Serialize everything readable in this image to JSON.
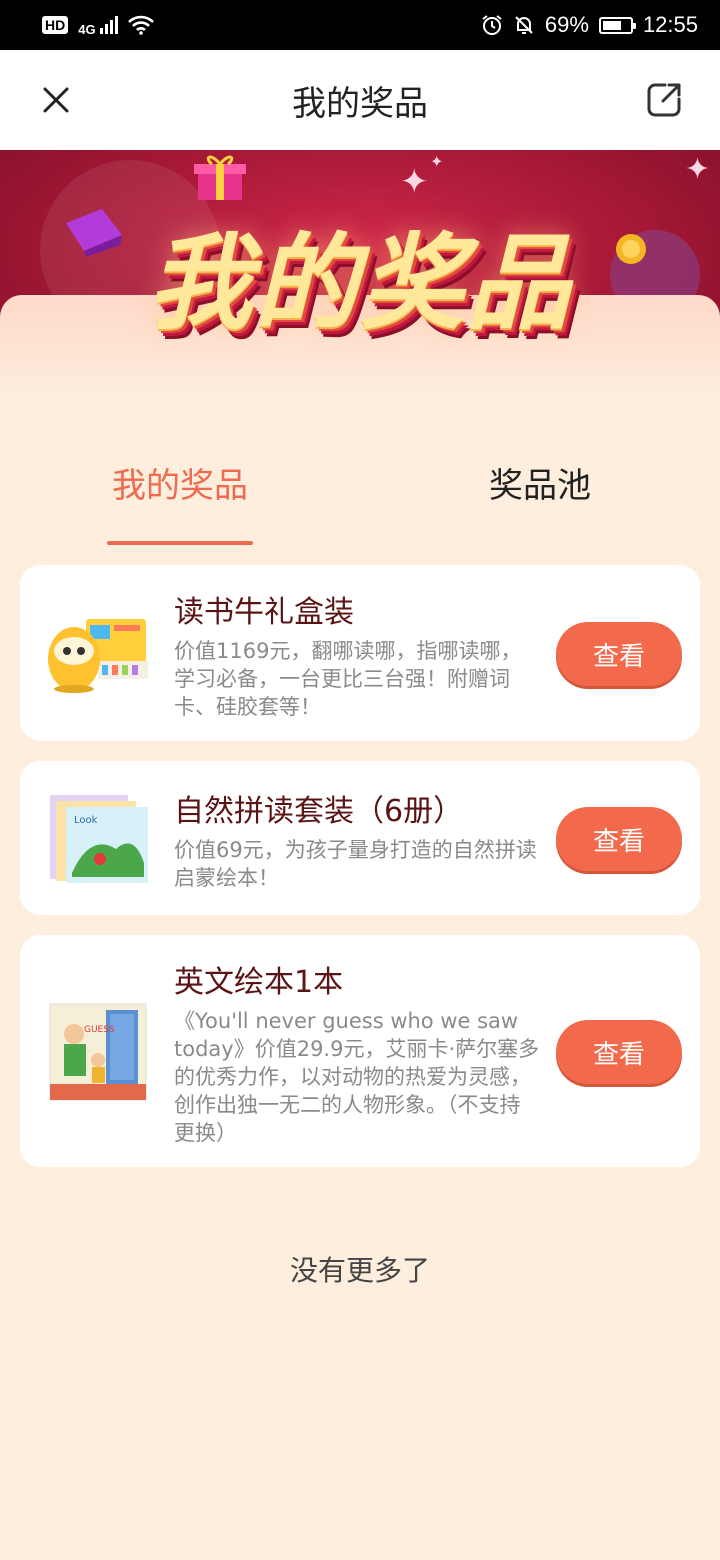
{
  "status": {
    "hd": "HD",
    "network": "4G",
    "battery_percent": "69%",
    "battery_level": 0.69,
    "time": "12:55"
  },
  "nav": {
    "title": "我的奖品",
    "close_icon": "close-icon",
    "share_icon": "share-icon"
  },
  "banner": {
    "title": "我的奖品"
  },
  "tabs": [
    {
      "label": "我的奖品",
      "active": true
    },
    {
      "label": "奖品池",
      "active": false
    }
  ],
  "prizes": [
    {
      "name": "读书牛礼盒装",
      "desc": "价值1169元，翻哪读哪，指哪读哪，学习必备，一台更比三台强！附赠词卡、硅胶套等！",
      "button": "查看"
    },
    {
      "name": "自然拼读套装（6册）",
      "desc": "价值69元，为孩子量身打造的自然拼读启蒙绘本！",
      "button": "查看"
    },
    {
      "name": "英文绘本1本",
      "desc": "《You'll never guess who we saw today》价值29.9元，艾丽卡·萨尔塞多的优秀力作，以对动物的热爱为灵感，创作出独一无二的人物形象。（不支持更换）",
      "button": "查看"
    }
  ],
  "footer": {
    "no_more": "没有更多了"
  },
  "colors": {
    "accent": "#ef6a4e",
    "button": "#f26a4b",
    "background": "#fdeedd",
    "prize_name": "#5a1414"
  }
}
